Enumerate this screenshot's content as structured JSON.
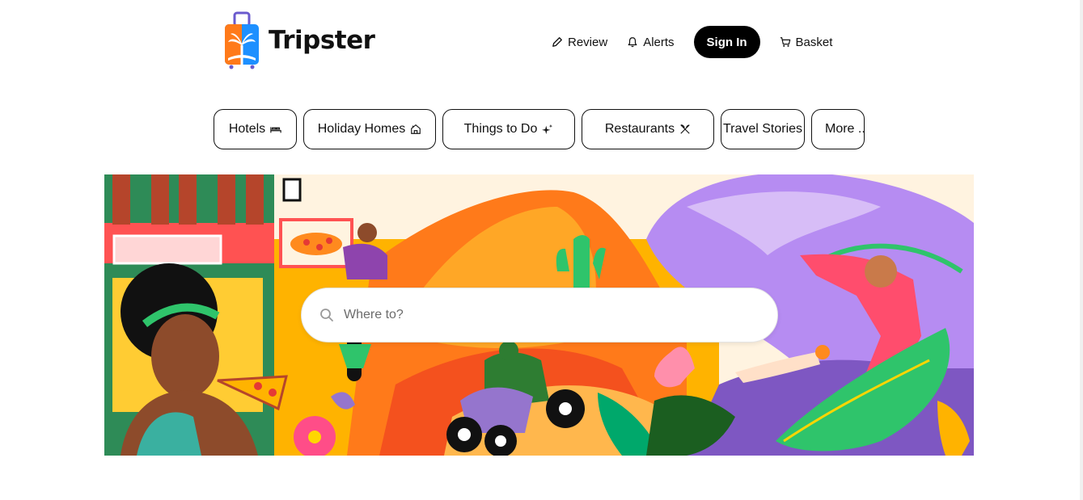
{
  "brand": {
    "name": "Tripster"
  },
  "header": {
    "review_label": "Review",
    "alerts_label": "Alerts",
    "signin_label": "Sign In",
    "basket_label": "Basket"
  },
  "categories": [
    {
      "label": "Hotels",
      "icon": "bed-icon"
    },
    {
      "label": "Holiday Homes",
      "icon": "house-icon"
    },
    {
      "label": "Things to Do",
      "icon": "sparkle-icon"
    },
    {
      "label": "Restaurants",
      "icon": "utensils-icon"
    },
    {
      "label": "Travel Stories",
      "icon": ""
    },
    {
      "label": "More ...",
      "icon": ""
    }
  ],
  "search": {
    "placeholder": "Where to?"
  },
  "colors": {
    "accent_dark": "#000000",
    "hero_orange": "#ff8a1e",
    "hero_purple": "#b68cf2",
    "hero_green": "#2fc46b",
    "hero_red": "#f03a3a"
  }
}
